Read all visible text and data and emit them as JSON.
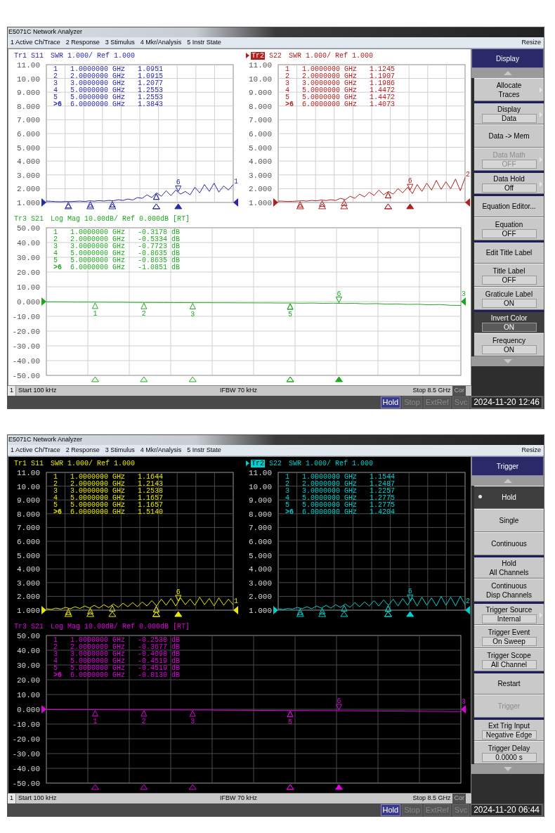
{
  "screens": [
    {
      "dark_background": false,
      "title": "E5071C Network Analyzer",
      "menu": [
        "1 Active Ch/Trace",
        "2 Response",
        "3 Stimulus",
        "4 Mkr/Analysis",
        "5 Instr State"
      ],
      "resize": "Resize",
      "traces": [
        {
          "name": "Tr1",
          "active": false,
          "format": "SWR 1.000/ Ref 1.000",
          "kind": "swr",
          "end_label": "1",
          "chart_data": {
            "type": "line",
            "grid": true,
            "ylim": [
              1,
              11
            ],
            "yticks": [
              {
                "value": 11,
                "label": "11.00"
              },
              {
                "value": 10,
                "label": "10.00"
              },
              {
                "value": 9,
                "label": "9.000"
              },
              {
                "value": 8,
                "label": "8.000"
              },
              {
                "value": 7,
                "label": "7.000"
              },
              {
                "value": 6,
                "label": "6.000"
              },
              {
                "value": 5,
                "label": "5.000"
              },
              {
                "value": 4,
                "label": "4.000"
              },
              {
                "value": 3,
                "label": "3.000"
              },
              {
                "value": 2,
                "label": "2.000"
              },
              {
                "value": 1,
                "label": "1.000"
              }
            ],
            "series": [
              {
                "name": "S11",
                "color": "#2a2aa8",
                "values": [
                  1.1,
                  1.08,
                  1.06,
                  1.05,
                  1.07,
                  1.06,
                  1.08,
                  1.1,
                  1.07,
                  1.12,
                  1.09,
                  1.14,
                  1.1,
                  1.15,
                  1.12,
                  1.2,
                  1.15,
                  1.25,
                  1.18,
                  1.35,
                  1.3,
                  1.55,
                  1.35,
                  1.7,
                  1.45,
                  1.85,
                  1.5,
                  1.9,
                  1.6,
                  1.8,
                  1.55,
                  2.1,
                  1.7,
                  2.3,
                  1.8,
                  2.4,
                  1.75,
                  2.2,
                  1.9,
                  2.3
                ]
              }
            ]
          },
          "markers": [
            {
              "num": "1",
              "freq": "1.0000000 GHz",
              "value": "1.0951",
              "active": false
            },
            {
              "num": "2",
              "freq": "2.0000000 GHz",
              "value": "1.0915",
              "active": false
            },
            {
              "num": "3",
              "freq": "3.0000000 GHz",
              "value": "1.2077",
              "active": false
            },
            {
              "num": "4",
              "freq": "5.0000000 GHz",
              "value": "1.2553",
              "active": false
            },
            {
              "num": "5",
              "freq": "5.0000000 GHz",
              "value": "1.2553",
              "active": false
            },
            {
              "num": ">6",
              "freq": "6.0000000 GHz",
              "value": "1.3843",
              "active": true,
              "plot_label": "6"
            }
          ]
        },
        {
          "name": "Tr2",
          "active": true,
          "format": "SWR 1.000/ Ref 1.000",
          "kind": "swr",
          "end_label": "2",
          "chart_data": {
            "type": "line",
            "grid": true,
            "ylim": [
              1,
              11
            ],
            "yticks": [
              {
                "value": 11,
                "label": "11.00"
              },
              {
                "value": 10,
                "label": "10.00"
              },
              {
                "value": 9,
                "label": "9.000"
              },
              {
                "value": 8,
                "label": "8.000"
              },
              {
                "value": 7,
                "label": "7.000"
              },
              {
                "value": 6,
                "label": "6.000"
              },
              {
                "value": 5,
                "label": "5.000"
              },
              {
                "value": 4,
                "label": "4.000"
              },
              {
                "value": 3,
                "label": "3.000"
              },
              {
                "value": 2,
                "label": "2.000"
              },
              {
                "value": 1,
                "label": "1.000"
              }
            ],
            "series": [
              {
                "name": "S22",
                "color": "#b02020",
                "values": [
                  1.1,
                  1.09,
                  1.07,
                  1.08,
                  1.1,
                  1.12,
                  1.1,
                  1.15,
                  1.12,
                  1.18,
                  1.14,
                  1.2,
                  1.15,
                  1.3,
                  1.2,
                  1.45,
                  1.3,
                  1.6,
                  1.4,
                  1.75,
                  1.5,
                  1.9,
                  1.55,
                  1.8,
                  1.6,
                  2.0,
                  1.7,
                  2.1,
                  1.65,
                  2.3,
                  1.8,
                  2.4,
                  1.9,
                  2.6,
                  1.95,
                  2.5,
                  2.0,
                  2.7,
                  1.85,
                  2.8
                ]
              }
            ]
          },
          "markers": [
            {
              "num": "1",
              "freq": "1.0000000 GHz",
              "value": "1.1245",
              "active": false
            },
            {
              "num": "2",
              "freq": "2.0000000 GHz",
              "value": "1.1907",
              "active": false
            },
            {
              "num": "3",
              "freq": "3.0000000 GHz",
              "value": "1.1986",
              "active": false
            },
            {
              "num": "4",
              "freq": "5.0000000 GHz",
              "value": "1.4472",
              "active": false
            },
            {
              "num": "5",
              "freq": "5.0000000 GHz",
              "value": "1.4472",
              "active": false
            },
            {
              "num": ">6",
              "freq": "6.0000000 GHz",
              "value": "1.4073",
              "active": true,
              "plot_label": "6"
            }
          ]
        },
        {
          "name": "Tr3",
          "active": false,
          "format": "Log Mag 10.00dB/ Ref 0.000dB [RT]",
          "kind": "logmag",
          "end_label": "3",
          "chart_data": {
            "type": "line",
            "grid": true,
            "ylim": [
              -50,
              50
            ],
            "yticks": [
              {
                "value": 50,
                "label": "50.00"
              },
              {
                "value": 40,
                "label": "40.00"
              },
              {
                "value": 30,
                "label": "30.00"
              },
              {
                "value": 20,
                "label": "20.00"
              },
              {
                "value": 10,
                "label": "10.00"
              },
              {
                "value": 0,
                "label": "0.000"
              },
              {
                "value": -10,
                "label": "-10.00"
              },
              {
                "value": -20,
                "label": "-20.00"
              },
              {
                "value": -30,
                "label": "-30.00"
              },
              {
                "value": -40,
                "label": "-40.00"
              },
              {
                "value": -50,
                "label": "-50.00"
              }
            ],
            "series": [
              {
                "name": "S21",
                "color": "#1fa81f",
                "values": [
                  -0.3,
                  -0.3,
                  -0.35,
                  -0.4,
                  -0.4,
                  -0.45,
                  -0.5,
                  -0.5,
                  -0.55,
                  -0.6,
                  -0.6,
                  -0.65,
                  -0.7,
                  -0.7,
                  -0.75,
                  -0.75,
                  -0.8,
                  -0.8,
                  -0.85,
                  -0.85,
                  -0.9,
                  -0.9,
                  -1.0,
                  -0.95,
                  -1.1,
                  -1.0,
                  -1.2,
                  -1.1,
                  -1.3,
                  -1.2,
                  -1.5,
                  -1.4,
                  -1.7,
                  -1.6,
                  -1.9,
                  -1.8,
                  -2.2,
                  -2.0,
                  -2.5,
                  -2.6
                ]
              }
            ]
          },
          "markers": [
            {
              "num": "1",
              "freq": "1.0000000 GHz",
              "value": "-0.3178 dB",
              "active": false,
              "plot_label": "1"
            },
            {
              "num": "2",
              "freq": "2.0000000 GHz",
              "value": "-0.5334 dB",
              "active": false,
              "plot_label": "2"
            },
            {
              "num": "3",
              "freq": "3.0000000 GHz",
              "value": "-0.7723 dB",
              "active": false,
              "plot_label": "3"
            },
            {
              "num": "4",
              "freq": "5.0000000 GHz",
              "value": "-0.8635 dB",
              "active": false
            },
            {
              "num": "5",
              "freq": "5.0000000 GHz",
              "value": "-0.8635 dB",
              "active": false,
              "plot_label": "5"
            },
            {
              "num": ">6",
              "freq": "6.0000000 GHz",
              "value": "-1.0851 dB",
              "active": true,
              "plot_label": "6"
            }
          ]
        }
      ],
      "softkeys": {
        "title": "Display",
        "items": [
          {
            "kind": "plain",
            "lines": [
              "Allocate",
              "Traces"
            ],
            "submenu": true,
            "disabled": false,
            "pressed": false,
            "group_start": false
          },
          {
            "kind": "value",
            "lines": [
              "Display"
            ],
            "value": "Data",
            "submenu": true,
            "disabled": false,
            "pressed": false,
            "group_start": true
          },
          {
            "kind": "plain",
            "lines": [
              "Data -> Mem"
            ],
            "submenu": false,
            "disabled": false,
            "pressed": false,
            "group_start": false
          },
          {
            "kind": "value",
            "lines": [
              "Data Math"
            ],
            "value": "OFF",
            "submenu": true,
            "disabled": true,
            "pressed": false,
            "group_start": false
          },
          {
            "kind": "value",
            "lines": [
              "Data Hold"
            ],
            "value": "Off",
            "submenu": true,
            "disabled": false,
            "pressed": false,
            "group_start": true
          },
          {
            "kind": "plain",
            "lines": [
              "Equation Editor..."
            ],
            "submenu": false,
            "disabled": false,
            "pressed": false,
            "group_start": true
          },
          {
            "kind": "value",
            "lines": [
              "Equation"
            ],
            "value": "OFF",
            "submenu": false,
            "disabled": false,
            "pressed": false,
            "group_start": false
          },
          {
            "kind": "plain",
            "lines": [
              "Edit Title Label"
            ],
            "submenu": false,
            "disabled": false,
            "pressed": false,
            "group_start": true
          },
          {
            "kind": "value",
            "lines": [
              "Title Label"
            ],
            "value": "OFF",
            "submenu": false,
            "disabled": false,
            "pressed": false,
            "group_start": false
          },
          {
            "kind": "value",
            "lines": [
              "Graticule Label"
            ],
            "value": "ON",
            "submenu": false,
            "disabled": false,
            "pressed": false,
            "group_start": false
          },
          {
            "kind": "value",
            "lines": [
              "Invert Color"
            ],
            "value": "ON",
            "submenu": false,
            "disabled": false,
            "pressed": true,
            "group_start": true
          },
          {
            "kind": "value",
            "lines": [
              "Frequency"
            ],
            "value": "ON",
            "submenu": false,
            "disabled": false,
            "pressed": false,
            "group_start": false
          }
        ]
      },
      "status": {
        "channel": "1",
        "start": "Start 100 kHz",
        "ifbw": "IFBW 70 kHz",
        "stop": "Stop 8.5 GHz",
        "cor": "Cor"
      },
      "indicators": [
        {
          "label": "Hold",
          "on": true
        },
        {
          "label": "Stop",
          "on": false
        },
        {
          "label": "ExtRef",
          "on": false
        },
        {
          "label": "Svc",
          "on": false
        }
      ],
      "datetime": "2024-11-20 12:46"
    },
    {
      "dark_background": true,
      "title": "E5071C Network Analyzer",
      "menu": [
        "1 Active Ch/Trace",
        "2 Response",
        "3 Stimulus",
        "4 Mkr/Analysis",
        "5 Instr State"
      ],
      "resize": "Resize",
      "traces": [
        {
          "name": "Tr1",
          "active": false,
          "format": "SWR 1.000/ Ref 1.000",
          "kind": "swr",
          "end_label": "1",
          "chart_data": {
            "type": "line",
            "grid": true,
            "ylim": [
              1,
              11
            ],
            "yticks": [
              {
                "value": 11,
                "label": "11.00"
              },
              {
                "value": 10,
                "label": "10.00"
              },
              {
                "value": 9,
                "label": "9.000"
              },
              {
                "value": 8,
                "label": "8.000"
              },
              {
                "value": 7,
                "label": "7.000"
              },
              {
                "value": 6,
                "label": "6.000"
              },
              {
                "value": 5,
                "label": "5.000"
              },
              {
                "value": 4,
                "label": "4.000"
              },
              {
                "value": 3,
                "label": "3.000"
              },
              {
                "value": 2,
                "label": "2.000"
              },
              {
                "value": 1,
                "label": "1.000"
              }
            ],
            "series": [
              {
                "name": "S11",
                "color": "#e8e800",
                "values": [
                  1.1,
                  1.05,
                  1.15,
                  1.08,
                  1.2,
                  1.1,
                  1.25,
                  1.12,
                  1.3,
                  1.15,
                  1.35,
                  1.15,
                  1.4,
                  1.2,
                  1.45,
                  1.2,
                  1.5,
                  1.25,
                  1.55,
                  1.25,
                  1.6,
                  1.3,
                  1.7,
                  1.3,
                  1.8,
                  1.35,
                  1.85,
                  1.3,
                  1.9,
                  1.4,
                  1.8,
                  1.35,
                  1.95,
                  1.4,
                  1.85,
                  1.3,
                  1.9,
                  1.35,
                  1.8,
                  1.4
                ]
              }
            ]
          },
          "markers": [
            {
              "num": "1",
              "freq": "1.0000000 GHz",
              "value": "1.1644",
              "active": false
            },
            {
              "num": "2",
              "freq": "2.0000000 GHz",
              "value": "1.2143",
              "active": false
            },
            {
              "num": "3",
              "freq": "3.0000000 GHz",
              "value": "1.2538",
              "active": false
            },
            {
              "num": "4",
              "freq": "5.0000000 GHz",
              "value": "1.1657",
              "active": false
            },
            {
              "num": "5",
              "freq": "5.0000000 GHz",
              "value": "1.1657",
              "active": false
            },
            {
              "num": ">6",
              "freq": "6.0000000 GHz",
              "value": "1.5140",
              "active": true,
              "plot_label": "6"
            }
          ]
        },
        {
          "name": "Tr2",
          "active": true,
          "format": "SWR 1.000/ Ref 1.000",
          "kind": "swr",
          "end_label": "2",
          "chart_data": {
            "type": "line",
            "grid": true,
            "ylim": [
              1,
              11
            ],
            "yticks": [
              {
                "value": 11,
                "label": "11.00"
              },
              {
                "value": 10,
                "label": "10.00"
              },
              {
                "value": 9,
                "label": "9.000"
              },
              {
                "value": 8,
                "label": "8.000"
              },
              {
                "value": 7,
                "label": "7.000"
              },
              {
                "value": 6,
                "label": "6.000"
              },
              {
                "value": 5,
                "label": "5.000"
              },
              {
                "value": 4,
                "label": "4.000"
              },
              {
                "value": 3,
                "label": "3.000"
              },
              {
                "value": 2,
                "label": "2.000"
              },
              {
                "value": 1,
                "label": "1.000"
              }
            ],
            "series": [
              {
                "name": "S22",
                "color": "#00d0d0",
                "values": [
                  1.1,
                  1.05,
                  1.12,
                  1.08,
                  1.2,
                  1.1,
                  1.25,
                  1.1,
                  1.3,
                  1.15,
                  1.35,
                  1.15,
                  1.4,
                  1.2,
                  1.45,
                  1.2,
                  1.55,
                  1.25,
                  1.6,
                  1.3,
                  1.7,
                  1.3,
                  1.75,
                  1.35,
                  1.8,
                  1.3,
                  1.85,
                  1.35,
                  1.9,
                  1.3,
                  1.95,
                  1.35,
                  1.9,
                  1.3,
                  2.0,
                  1.35,
                  1.95,
                  1.3,
                  2.0,
                  1.4
                ]
              }
            ]
          },
          "markers": [
            {
              "num": "1",
              "freq": "1.0000000 GHz",
              "value": "1.1544",
              "active": false
            },
            {
              "num": "2",
              "freq": "2.0000000 GHz",
              "value": "1.2487",
              "active": false
            },
            {
              "num": "3",
              "freq": "3.0000000 GHz",
              "value": "1.2257",
              "active": false
            },
            {
              "num": "4",
              "freq": "5.0000000 GHz",
              "value": "1.2775",
              "active": false
            },
            {
              "num": "5",
              "freq": "5.0000000 GHz",
              "value": "1.2775",
              "active": false
            },
            {
              "num": ">6",
              "freq": "6.0000000 GHz",
              "value": "1.4204",
              "active": true,
              "plot_label": "6"
            }
          ]
        },
        {
          "name": "Tr3",
          "active": false,
          "format": "Log Mag 10.00dB/ Ref 0.000dB [RT]",
          "kind": "logmag",
          "end_label": "3",
          "chart_data": {
            "type": "line",
            "grid": true,
            "ylim": [
              -50,
              50
            ],
            "yticks": [
              {
                "value": 50,
                "label": "50.00"
              },
              {
                "value": 40,
                "label": "40.00"
              },
              {
                "value": 30,
                "label": "30.00"
              },
              {
                "value": 20,
                "label": "20.00"
              },
              {
                "value": 10,
                "label": "10.00"
              },
              {
                "value": 0,
                "label": "0.000"
              },
              {
                "value": -10,
                "label": "-10.00"
              },
              {
                "value": -20,
                "label": "-20.00"
              },
              {
                "value": -30,
                "label": "-30.00"
              },
              {
                "value": -40,
                "label": "-40.00"
              },
              {
                "value": -50,
                "label": "-50.00"
              }
            ],
            "series": [
              {
                "name": "S21",
                "color": "#e000e0",
                "values": [
                  -0.25,
                  -0.25,
                  -0.3,
                  -0.3,
                  -0.3,
                  -0.35,
                  -0.35,
                  -0.4,
                  -0.4,
                  -0.4,
                  -0.45,
                  -0.45,
                  -0.45,
                  -0.5,
                  -0.5,
                  -0.5,
                  -0.55,
                  -0.6,
                  -0.6,
                  -0.65,
                  -0.7,
                  -0.7,
                  -0.75,
                  -0.8,
                  -0.8,
                  -0.85,
                  -0.9,
                  -0.9,
                  -1.0,
                  -1.0,
                  -1.1,
                  -1.1,
                  -1.2,
                  -1.2,
                  -1.3,
                  -1.3,
                  -1.4,
                  -1.4,
                  -1.5,
                  -1.5
                ]
              }
            ]
          },
          "markers": [
            {
              "num": "1",
              "freq": "1.0000000 GHz",
              "value": "-0.2538 dB",
              "active": false,
              "plot_label": "1"
            },
            {
              "num": "2",
              "freq": "2.0000000 GHz",
              "value": "-0.3677 dB",
              "active": false,
              "plot_label": "2"
            },
            {
              "num": "3",
              "freq": "3.0000000 GHz",
              "value": "-0.4098 dB",
              "active": false,
              "plot_label": "3"
            },
            {
              "num": "4",
              "freq": "5.0000000 GHz",
              "value": "-0.4519 dB",
              "active": false
            },
            {
              "num": "5",
              "freq": "5.0000000 GHz",
              "value": "-0.4519 dB",
              "active": false,
              "plot_label": "5"
            },
            {
              "num": ">6",
              "freq": "6.0000000 GHz",
              "value": "-0.8130 dB",
              "active": true,
              "plot_label": "6"
            }
          ]
        }
      ],
      "softkeys": {
        "title": "Trigger",
        "items": [
          {
            "kind": "radio",
            "lines": [
              "Hold"
            ],
            "submenu": false,
            "disabled": false,
            "pressed": true,
            "group_start": false
          },
          {
            "kind": "radio",
            "lines": [
              "Single"
            ],
            "submenu": false,
            "disabled": false,
            "pressed": false,
            "group_start": false
          },
          {
            "kind": "radio",
            "lines": [
              "Continuous"
            ],
            "submenu": false,
            "disabled": false,
            "pressed": false,
            "group_start": false
          },
          {
            "kind": "plain",
            "lines": [
              "Hold",
              "All Channels"
            ],
            "submenu": false,
            "disabled": false,
            "pressed": false,
            "group_start": true
          },
          {
            "kind": "plain",
            "lines": [
              "Continuous",
              "Disp Channels"
            ],
            "submenu": false,
            "disabled": false,
            "pressed": false,
            "group_start": false
          },
          {
            "kind": "value",
            "lines": [
              "Trigger Source"
            ],
            "value": "Internal",
            "submenu": true,
            "disabled": false,
            "pressed": false,
            "group_start": true
          },
          {
            "kind": "value",
            "lines": [
              "Trigger Event"
            ],
            "value": "On Sweep",
            "submenu": false,
            "disabled": false,
            "pressed": false,
            "group_start": false
          },
          {
            "kind": "value",
            "lines": [
              "Trigger Scope"
            ],
            "value": "All Channel",
            "submenu": false,
            "disabled": false,
            "pressed": false,
            "group_start": false
          },
          {
            "kind": "plain",
            "lines": [
              "Restart"
            ],
            "submenu": false,
            "disabled": false,
            "pressed": false,
            "group_start": true
          },
          {
            "kind": "plain",
            "lines": [
              "Trigger"
            ],
            "submenu": false,
            "disabled": true,
            "pressed": false,
            "group_start": false
          },
          {
            "kind": "value",
            "lines": [
              "Ext Trig Input"
            ],
            "value": "Negative Edge",
            "submenu": false,
            "disabled": false,
            "pressed": false,
            "group_start": true
          },
          {
            "kind": "value",
            "lines": [
              "Trigger Delay"
            ],
            "value": "0.0000 s",
            "submenu": false,
            "disabled": false,
            "pressed": false,
            "group_start": false
          }
        ]
      },
      "status": {
        "channel": "1",
        "start": "Start 100 kHz",
        "ifbw": "IFBW 70 kHz",
        "stop": "Stop 8.5 GHz",
        "cor": "Cor"
      },
      "indicators": [
        {
          "label": "Hold",
          "on": true
        },
        {
          "label": "Stop",
          "on": false
        },
        {
          "label": "ExtRef",
          "on": false
        },
        {
          "label": "Svc",
          "on": false
        }
      ],
      "datetime": "2024-11-20 06:44"
    }
  ]
}
